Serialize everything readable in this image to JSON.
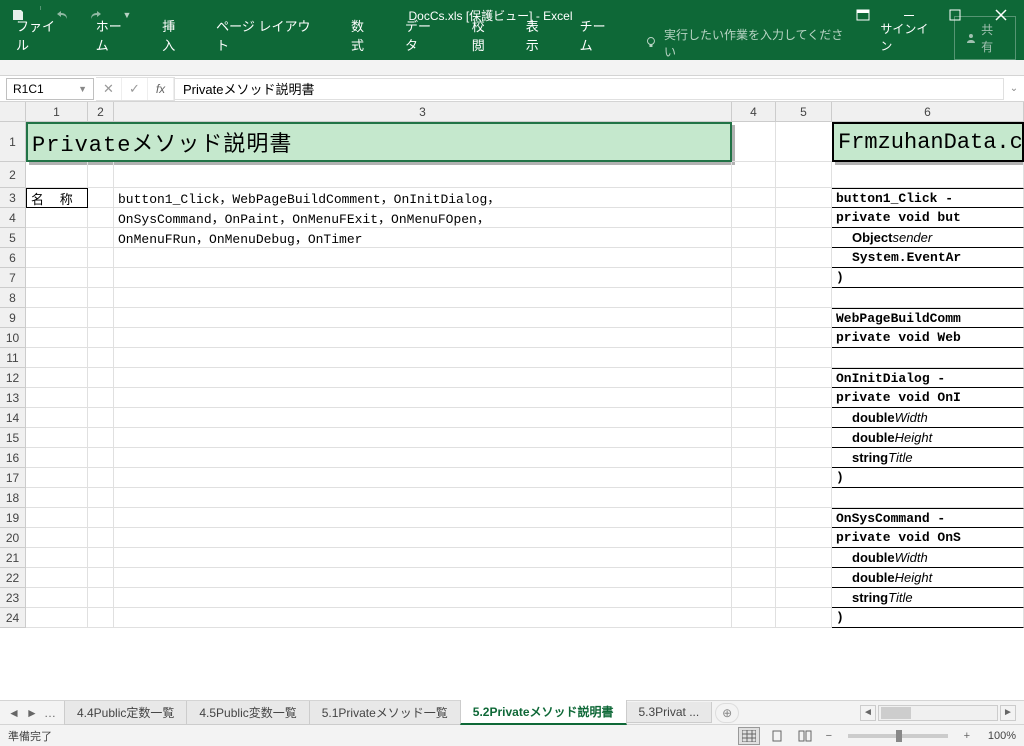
{
  "titlebar": {
    "title": "DocCs.xls [保護ビュー] - Excel"
  },
  "ribbon": {
    "file": "ファイル",
    "home": "ホーム",
    "insert": "挿入",
    "pagelayout": "ページ レイアウト",
    "formulas": "数式",
    "data": "データ",
    "review": "校閲",
    "view": "表示",
    "team": "チーム",
    "tellme": "実行したい作業を入力してください",
    "signin": "サインイン",
    "share": "共有"
  },
  "formula": {
    "namebox": "R1C1",
    "content": "Privateメソッド説明書"
  },
  "colheaders": [
    "1",
    "2",
    "3",
    "4",
    "5",
    "6"
  ],
  "rows": [
    "1",
    "2",
    "3",
    "4",
    "5",
    "6",
    "7",
    "8",
    "9",
    "10",
    "11",
    "12",
    "13",
    "14",
    "15",
    "16",
    "17",
    "18",
    "19",
    "20",
    "21",
    "22",
    "23",
    "24"
  ],
  "sheet": {
    "title1": "Privateメソッド説明書",
    "title2": "FrmzuhanData.c",
    "label_name": "名 称",
    "line3": "button1_Click，WebPageBuildComment，OnInitDialog，",
    "line4": "OnSysCommand，OnPaint，OnMenuFExit，OnMenuFOpen，",
    "line5": "OnMenuFRun，OnMenuDebug，OnTimer",
    "r3c6": "button1_Click -",
    "r4c6": "private void but",
    "r5c6_a": "Object ",
    "r5c6_b": "sender",
    "r6c6_a": "System.EventAr",
    "r7c6": ")",
    "r9c6": "WebPageBuildComm",
    "r10c6": "private void Web",
    "r12c6": "OnInitDialog - ",
    "r13c6": "private void OnI",
    "r14c6_a": "double ",
    "r14c6_b": "Width",
    "r15c6_a": "double ",
    "r15c6_b": "Height",
    "r16c6_a": "string ",
    "r16c6_b": "Title",
    "r17c6": ")",
    "r19c6": "OnSysCommand - ",
    "r20c6": "private void OnS",
    "r21c6_a": "double ",
    "r21c6_b": "Width",
    "r22c6_a": "double ",
    "r22c6_b": "Height",
    "r23c6_a": "string ",
    "r23c6_b": "Title",
    "r24c6": ")"
  },
  "tabs": {
    "t1": "4.4Public定数一覧",
    "t2": "4.5Public変数一覧",
    "t3": "5.1Privateメソッド一覧",
    "t4": "5.2Privateメソッド説明書",
    "t5": "5.3Privat ..."
  },
  "status": {
    "ready": "準備完了",
    "zoom": "100%"
  }
}
